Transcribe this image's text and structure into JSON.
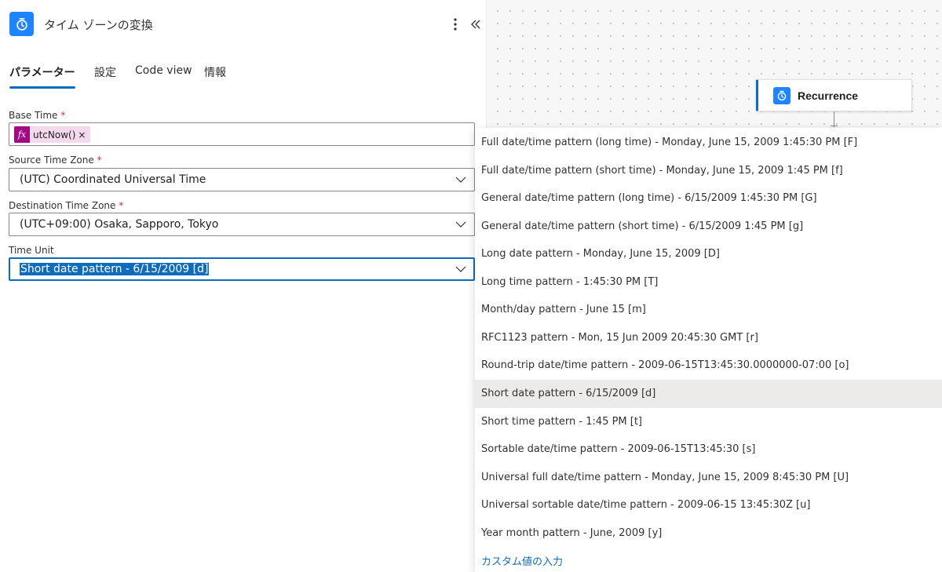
{
  "panel": {
    "title": "タイム ゾーンの変換",
    "more_icon": "more-vertical-icon",
    "collapse_icon": "double-chevron-left-icon",
    "header_icon": "alarm-clock-icon",
    "accent_color": "#1f85ff"
  },
  "tabs": [
    {
      "label": "パラメーター",
      "active": true
    },
    {
      "label": "設定",
      "active": false
    },
    {
      "label": "Code view",
      "active": false
    },
    {
      "label": "情報",
      "active": false
    }
  ],
  "fields": {
    "base_time": {
      "label": "Base Time",
      "required": "*",
      "token_icon": "fx",
      "token_text": "utcNow()",
      "token_remove": "×"
    },
    "source_tz": {
      "label": "Source Time Zone",
      "required": "*",
      "value": "(UTC) Coordinated Universal Time"
    },
    "dest_tz": {
      "label": "Destination Time Zone",
      "required": "*",
      "value": "(UTC+09:00) Osaka, Sapporo, Tokyo"
    },
    "time_unit": {
      "label": "Time Unit",
      "value": "Short date pattern - 6/15/2009 [d]"
    }
  },
  "canvas": {
    "card_title": "Recurrence",
    "card_icon": "alarm-clock-icon"
  },
  "dropdown": {
    "options": [
      "Full date/time pattern (long time) - Monday, June 15, 2009 1:45:30 PM [F]",
      "Full date/time pattern (short time) - Monday, June 15, 2009 1:45 PM [f]",
      "General date/time pattern (long time) - 6/15/2009 1:45:30 PM [G]",
      "General date/time pattern (short time) - 6/15/2009 1:45 PM [g]",
      "Long date pattern - Monday, June 15, 2009 [D]",
      "Long time pattern - 1:45:30 PM [T]",
      "Month/day pattern - June 15 [m]",
      "RFC1123 pattern - Mon, 15 Jun 2009 20:45:30 GMT [r]",
      "Round-trip date/time pattern - 2009-06-15T13:45:30.0000000-07:00 [o]",
      "Short date pattern - 6/15/2009 [d]",
      "Short time pattern - 1:45 PM [t]",
      "Sortable date/time pattern - 2009-06-15T13:45:30 [s]",
      "Universal full date/time pattern - Monday, June 15, 2009 8:45:30 PM [U]",
      "Universal sortable date/time pattern - 2009-06-15 13:45:30Z [u]",
      "Year month pattern - June, 2009 [y]"
    ],
    "highlighted_index": 9,
    "custom_label": "カスタム値の入力"
  }
}
